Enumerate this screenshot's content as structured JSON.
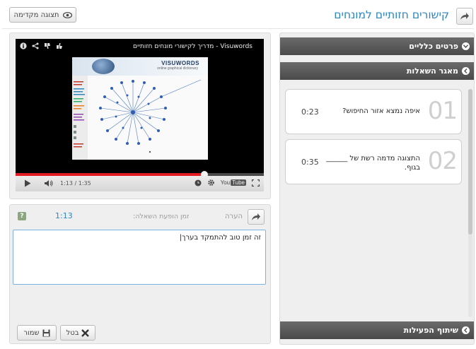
{
  "header": {
    "title": "קישורים חזותיים למונחים",
    "preview_label": "תצוגה מקדימה"
  },
  "video": {
    "title": "Visuwords - מדריך לקישורי מונחים חזותיים",
    "time": "1:13 / 1:35",
    "progress": 0.76,
    "screenshot_logo": "VISUWORDS",
    "screenshot_sub": "online graphical dictionary",
    "youtube_label": "You",
    "youtube_tube": "Tube"
  },
  "comment": {
    "label": "הערה",
    "question_time_label": "זמן הופעת השאלה:",
    "question_time_value": "1:13",
    "help": "?",
    "text": "זה זמן טוב להתמקד בערך|"
  },
  "buttons": {
    "save": "שמור",
    "cancel": "בטל"
  },
  "accordion": {
    "general": "פרטים כלליים",
    "questions": "מאגר השאלות",
    "share": "שיתוף הפעילות"
  },
  "questions": [
    {
      "num": "01",
      "text": "איפה נמצא אזור החיפוש?",
      "time": "0:23"
    },
    {
      "num": "02",
      "text": "התצוגה מדמה רשת של ______ בגוף.",
      "time": "0:35"
    }
  ],
  "colors": {
    "accent": "#2e86c1",
    "progress": "#e31b23",
    "accordion": "#555555"
  }
}
